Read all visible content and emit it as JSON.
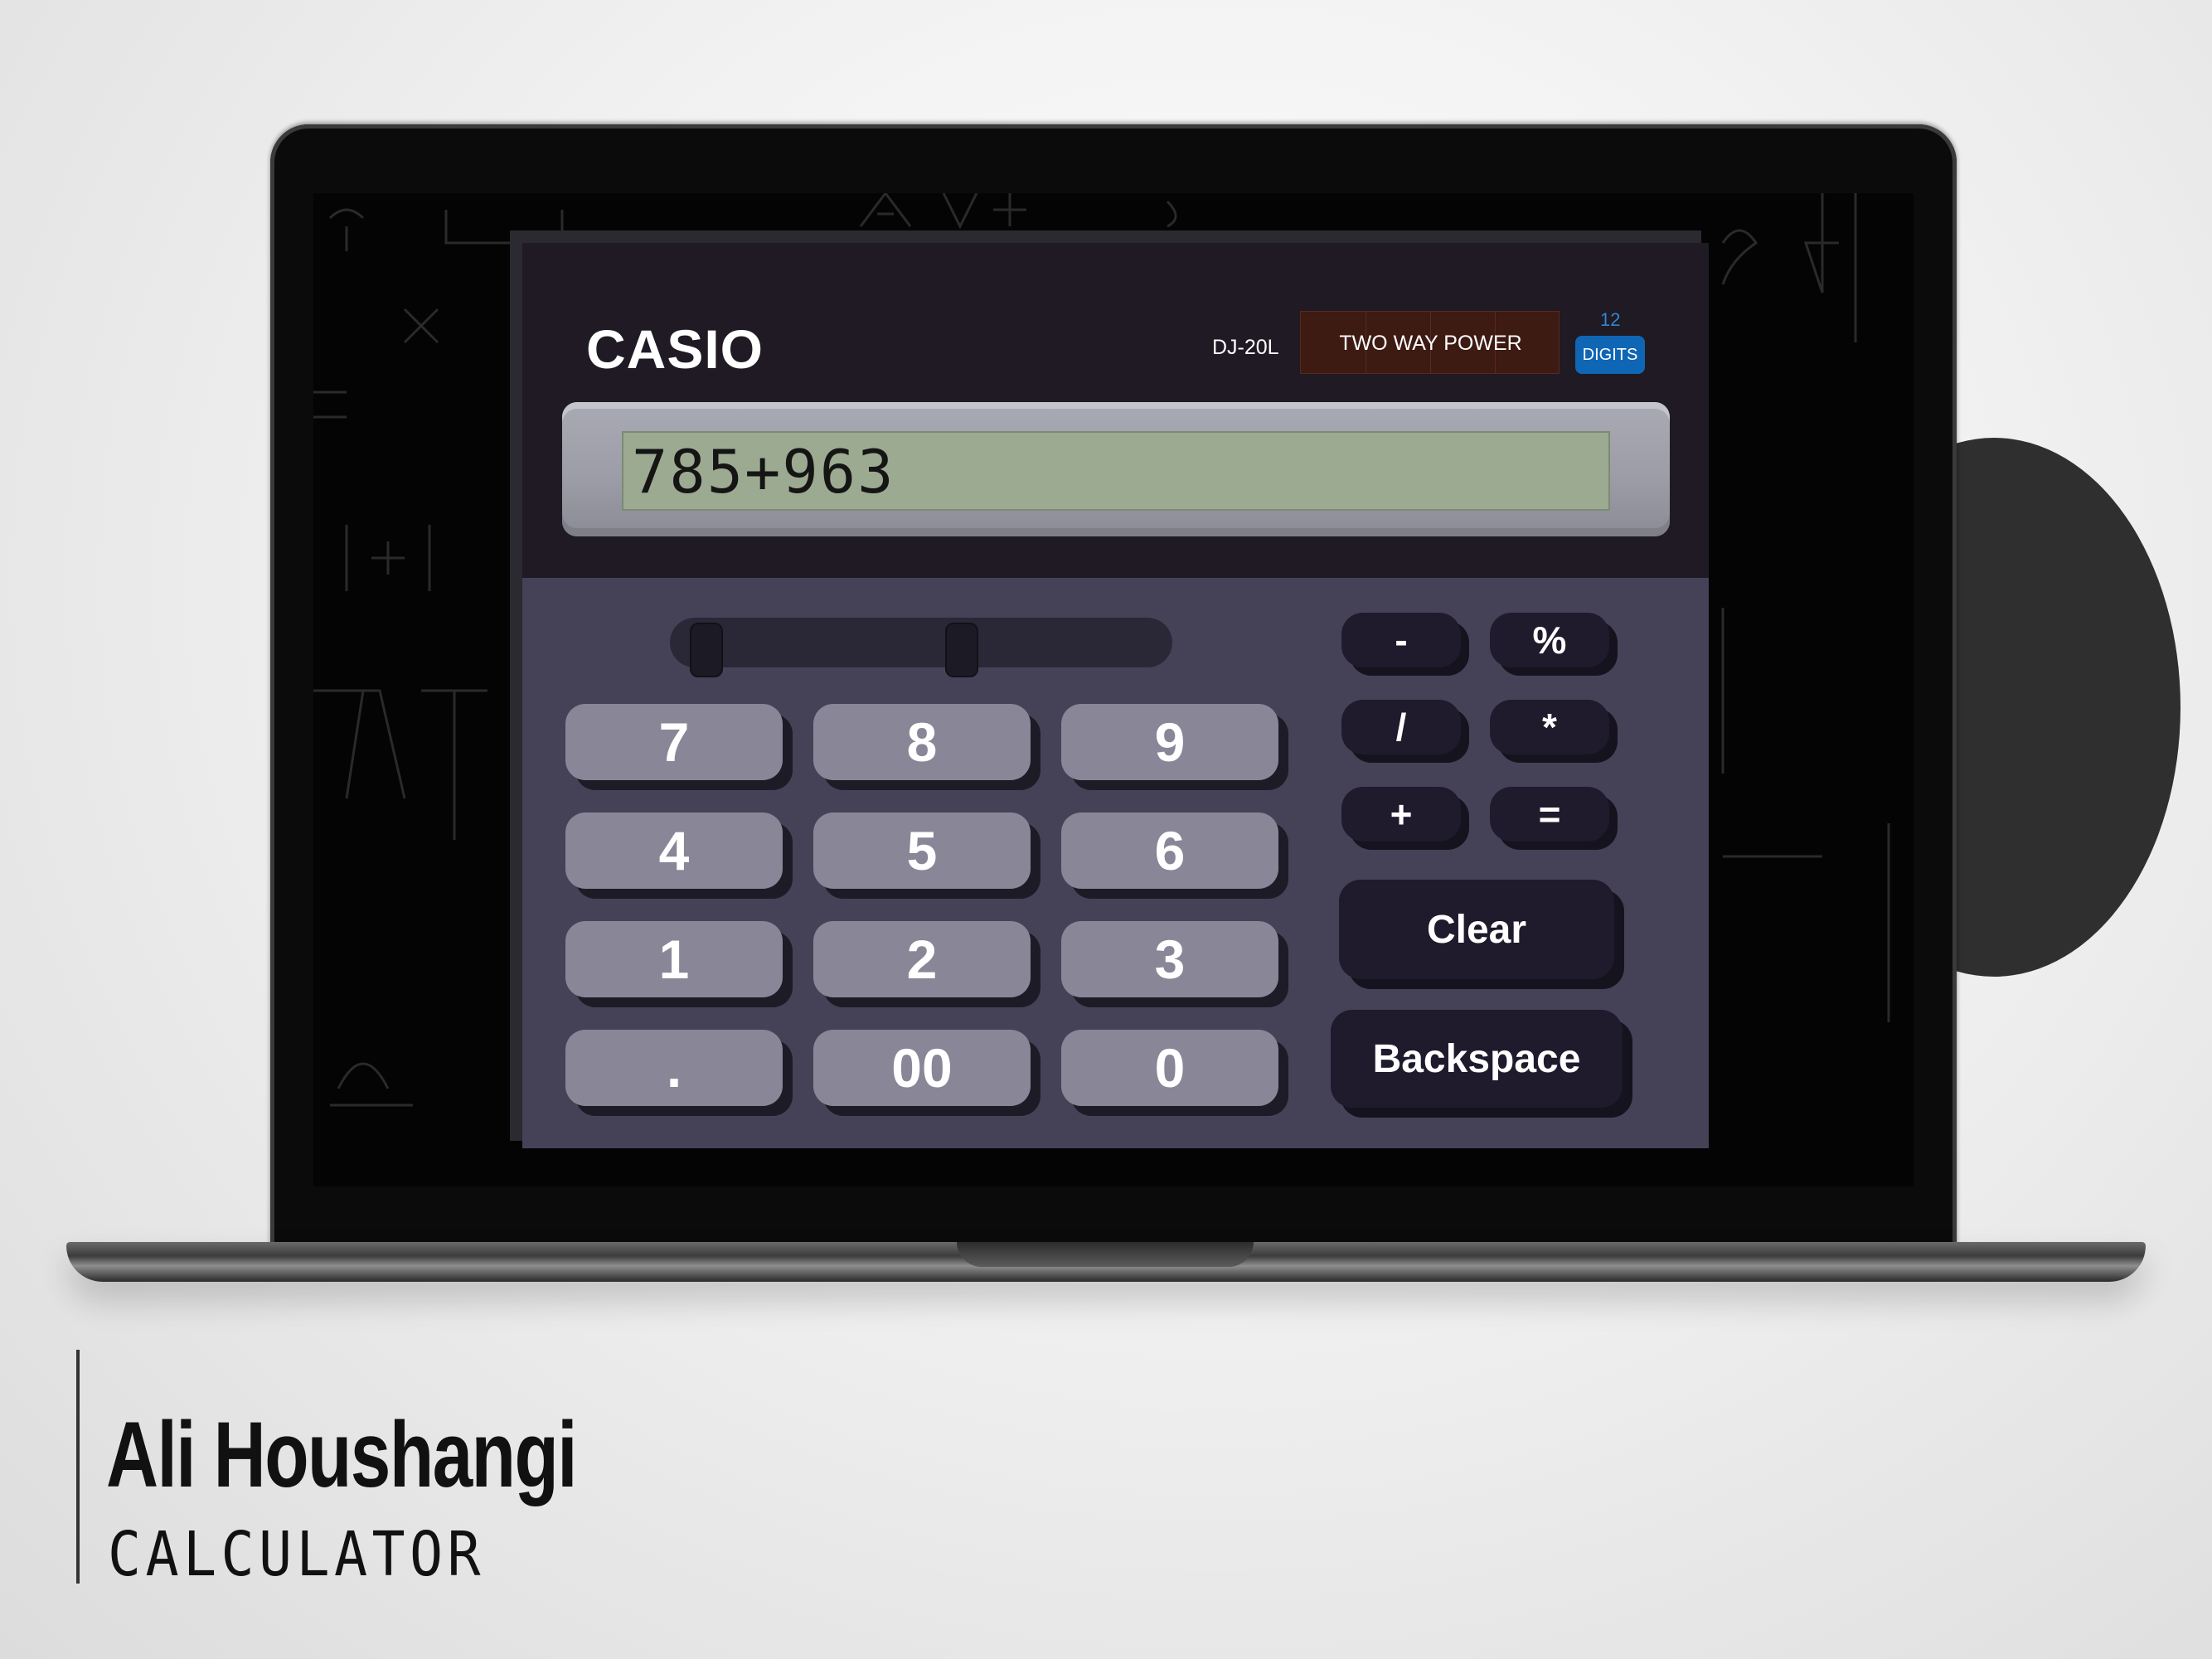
{
  "calculator": {
    "brand": "CASIO",
    "model": "DJ-20L",
    "power_label": "TWO WAY POWER",
    "digits_count": "12",
    "digits_label": "DIGITS",
    "display_value": "785+963",
    "keys": {
      "k7": "7",
      "k8": "8",
      "k9": "9",
      "k4": "4",
      "k5": "5",
      "k6": "6",
      "k1": "1",
      "k2": "2",
      "k3": "3",
      "kdot": ".",
      "k00": "00",
      "k0": "0",
      "minus": "-",
      "percent": "%",
      "divide": "/",
      "multiply": "*",
      "plus": "+",
      "equals": "=",
      "clear": "Clear",
      "backspace": "Backspace"
    }
  },
  "signature": {
    "name": "Ali Houshangi",
    "subtitle": "CALCULATOR"
  },
  "colors": {
    "calculator_body": "#454258",
    "calculator_top": "#1f1a23",
    "lcd": "#9caa91",
    "number_key": "#888697",
    "operator_key": "#1f1b2c",
    "digits_badge": "#0f66b4",
    "power_badge": "#3d1a12"
  }
}
